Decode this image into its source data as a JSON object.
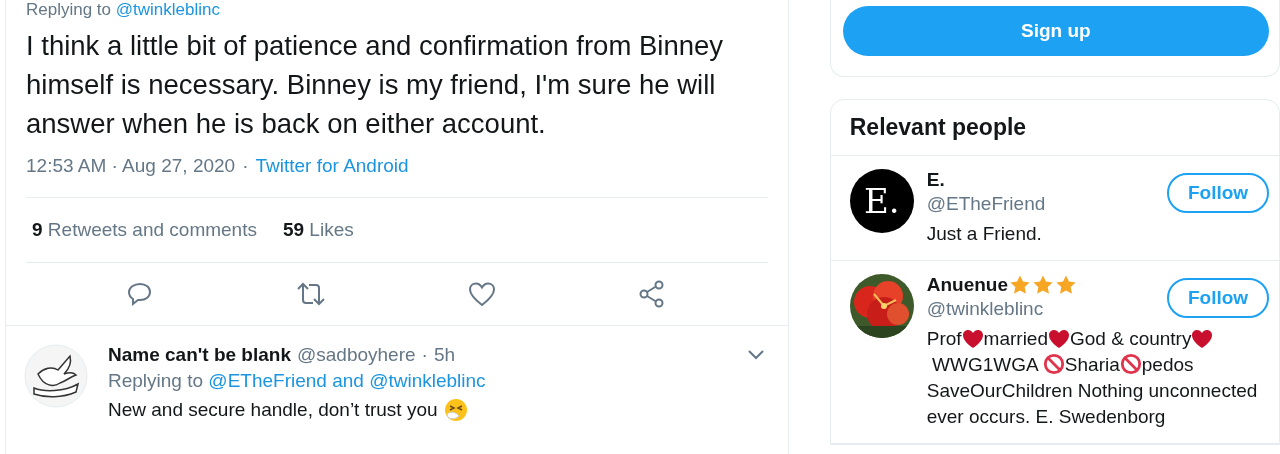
{
  "tweet": {
    "replying_label": "Replying to",
    "replying_to": "@twinkleblinc",
    "text": "I think a little bit of patience and confirmation from Binney himself is necessary. Binney is my friend, I'm sure he will answer when he is back on either account.",
    "time": "12:53 AM · Aug 27, 2020",
    "separator": "·",
    "source": "Twitter for Android",
    "stats": [
      {
        "count": "9",
        "label": "Retweets and comments"
      },
      {
        "count": "59",
        "label": "Likes"
      }
    ],
    "actions": [
      {
        "kind": "reply"
      },
      {
        "kind": "retweet"
      },
      {
        "kind": "like"
      },
      {
        "kind": "share"
      }
    ]
  },
  "reply": {
    "name": "Name can't be blank",
    "handle": "@sadboyhere",
    "separator": "·",
    "age": "5h",
    "replying_label": "Replying to",
    "replying_to": "@ETheFriend and @twinkleblinc",
    "text": "New and secure handle, don’t trust you",
    "emoji": {
      "kind": "sneeze"
    }
  },
  "signup": {
    "label": "Sign up"
  },
  "relevant_people": {
    "title": "Relevant people",
    "people": [
      {
        "name": "E.",
        "avatar": {
          "kind": "letter",
          "text": "E."
        },
        "handle": "@ETheFriend",
        "follow": "Follow",
        "bio": [
          {
            "kind": "text",
            "text": "Just a Friend."
          }
        ]
      },
      {
        "name": "Anuenue",
        "avatar": {
          "kind": "picture"
        },
        "name_marks": [
          {
            "kind": "star"
          },
          {
            "kind": "star"
          },
          {
            "kind": "star"
          }
        ],
        "handle": "@twinkleblinc",
        "follow": "Follow",
        "bio": [
          {
            "kind": "text",
            "text": "Prof"
          },
          {
            "kind": "heart"
          },
          {
            "kind": "text",
            "text": "married"
          },
          {
            "kind": "heart"
          },
          {
            "kind": "text",
            "text": "God & country"
          },
          {
            "kind": "heart"
          },
          {
            "kind": "text",
            "text": " WWG1WGA "
          },
          {
            "kind": "prohibited"
          },
          {
            "kind": "text",
            "text": "Sharia"
          },
          {
            "kind": "prohibited"
          },
          {
            "kind": "text",
            "text": "pedos"
          },
          {
            "kind": "text",
            "text": "SaveOurChildren Nothing unconnected"
          },
          {
            "kind": "text",
            "text": "ever occurs. E. Swedenborg"
          }
        ]
      }
    ]
  }
}
